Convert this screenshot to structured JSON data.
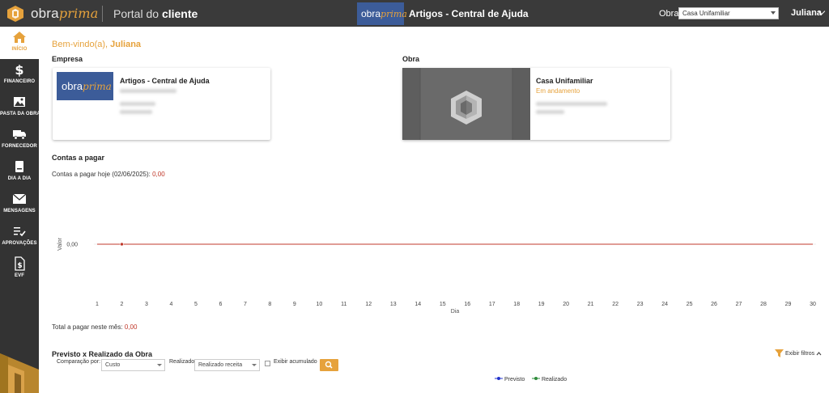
{
  "header": {
    "logo_obra": "obra",
    "logo_prima": "prima",
    "portal_prefix": "Portal do ",
    "portal_bold": "cliente",
    "center_logo_obra": "obra",
    "center_logo_prima": "prima",
    "company_title": "Artigos - Central de Ajuda",
    "obra_label": "Obra",
    "obra_selected": "Casa Unifamiliar",
    "user_name": "Juliana"
  },
  "sidebar": {
    "items": [
      {
        "label": "INÍCIO"
      },
      {
        "label": "FINANCEIRO"
      },
      {
        "label": "PASTA DA OBRA"
      },
      {
        "label": "FORNECEDOR"
      },
      {
        "label": "DIA A DIA"
      },
      {
        "label": "MENSAGENS"
      },
      {
        "label": "APROVAÇÕES"
      },
      {
        "label": "EVF"
      }
    ]
  },
  "main": {
    "welcome_prefix": "Bem-vindo(a), ",
    "welcome_name": "Juliana",
    "empresa_title": "Empresa",
    "empresa_name": "Artigos - Central de Ajuda",
    "empresa_logo_obra": "obra",
    "empresa_logo_prima": "prima",
    "obra_title": "Obra",
    "obra_name": "Casa Unifamiliar",
    "obra_status": "Em andamento",
    "contas_title": "Contas a pagar",
    "contas_hoje_label": "Contas a pagar hoje (02/06/2025): ",
    "contas_hoje_value": "0,00",
    "total_mes_label": "Total a pagar neste mês: ",
    "total_mes_value": "0,00",
    "previsto_title": "Previsto x Realizado da Obra",
    "exibir_filtros": "Exibir filtros",
    "comparacao_label": "Comparação por:",
    "comparacao_value": "Custo",
    "realizado_label": "Realizado",
    "realizado_value": "Realizado receita",
    "acumulado_label": "Exibir acumulado",
    "legend_previsto": "Previsto",
    "legend_realizado": "Realizado"
  },
  "colors": {
    "accent": "#e6a23c",
    "topbar": "#3a3a3a",
    "sidebar": "#333333",
    "brand_blue": "#3c5c99",
    "line_red": "#c0392b",
    "previsto_blue": "#2233cc",
    "realizado_green": "#2e8b3a"
  },
  "chart_data": {
    "type": "line",
    "xlabel": "Dia",
    "ylabel": "Valor",
    "x": [
      1,
      2,
      3,
      4,
      5,
      6,
      7,
      8,
      9,
      10,
      11,
      12,
      13,
      14,
      15,
      16,
      17,
      18,
      19,
      20,
      21,
      22,
      23,
      24,
      25,
      26,
      27,
      28,
      29,
      30
    ],
    "y_ticks": [
      "0,00"
    ],
    "series": [
      {
        "values": [
          0,
          0,
          0,
          0,
          0,
          0,
          0,
          0,
          0,
          0,
          0,
          0,
          0,
          0,
          0,
          0,
          0,
          0,
          0,
          0,
          0,
          0,
          0,
          0,
          0,
          0,
          0,
          0,
          0,
          0
        ],
        "marker_at": 2
      }
    ]
  }
}
